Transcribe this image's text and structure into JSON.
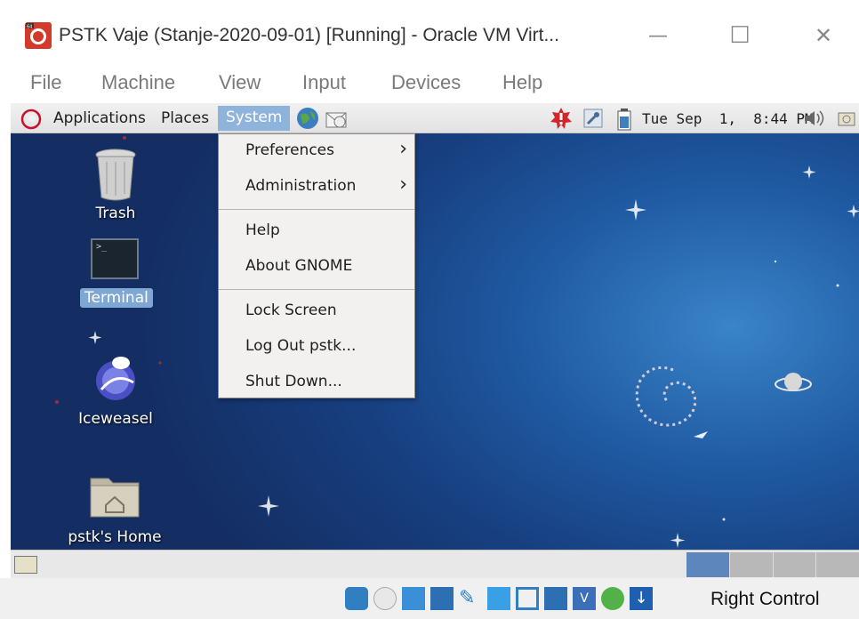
{
  "window": {
    "title": "PSTK Vaje (Stanje-2020-09-01) [Running] - Oracle VM Virt...",
    "minimize_glyph": "—",
    "maximize_glyph": "☐",
    "close_glyph": "✕"
  },
  "vm_menu": [
    "File",
    "Machine",
    "View",
    "Input",
    "Devices",
    "Help"
  ],
  "gnome_panel": {
    "applications": "Applications",
    "places": "Places",
    "system": "System",
    "clock": "Tue Sep  1,  8:44 PM"
  },
  "system_menu": {
    "items": [
      "Preferences",
      "Administration",
      "Help",
      "About GNOME",
      "Lock Screen",
      "Log Out pstk...",
      "Shut Down..."
    ],
    "submenu_arrow": "›"
  },
  "desktop_icons": [
    "Trash",
    "Terminal",
    "Iceweasel",
    "pstk's Home"
  ],
  "status_bar": {
    "host_key": "Right Control"
  },
  "colors": {
    "panel_highlight": "#8fb4dc",
    "desktop_bg": "#1f5aa2",
    "menu_bg": "#f2f1f0"
  },
  "icons": [
    "debian-swirl-icon",
    "network-globe-icon",
    "mail-icon",
    "update-alert-icon",
    "keyring-icon",
    "battery-icon",
    "volume-icon",
    "screenshot-icon",
    "hard-disk-icon",
    "optical-disk-icon",
    "usb-icon",
    "network-adapter-icon",
    "pen-icon",
    "shared-folder-icon",
    "display-icon",
    "video-capture-icon",
    "vbox-icon",
    "mouse-integration-icon",
    "host-key-arrow-icon"
  ]
}
